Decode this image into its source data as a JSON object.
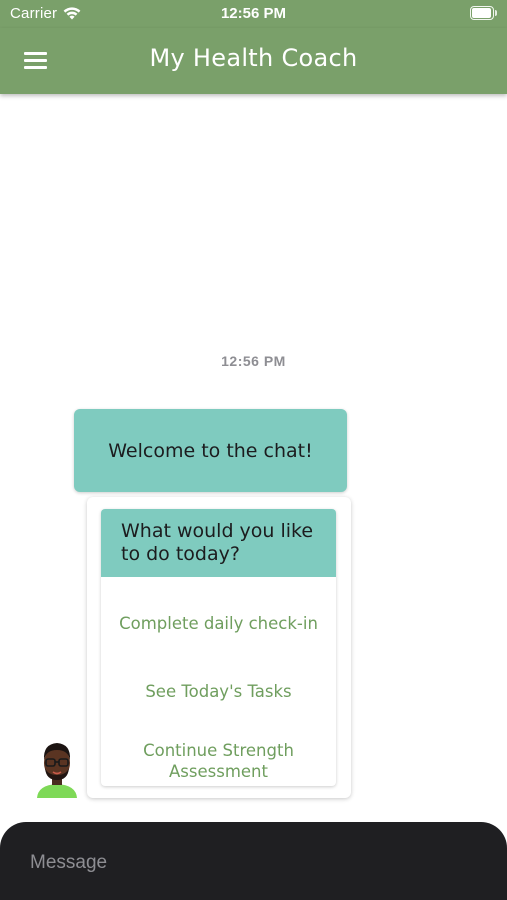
{
  "status_bar": {
    "carrier": "Carrier",
    "time": "12:56 PM"
  },
  "header": {
    "title": "My Health Coach",
    "menu_icon": "hamburger-menu-icon",
    "background": "#7aa06a"
  },
  "chat": {
    "timestamp": "12:56 PM",
    "welcome_message": "Welcome to the chat!",
    "bubble_color": "#7fcbbf",
    "prompt": "What would you like to do today?",
    "options": [
      {
        "label": "Complete daily check-in"
      },
      {
        "label": "See Today's Tasks"
      },
      {
        "label": "Continue Strength Assessment"
      }
    ],
    "option_color": "#6f9e5e",
    "avatar_icon": "coach-avatar-icon"
  },
  "composer": {
    "placeholder": "Message",
    "value": ""
  }
}
